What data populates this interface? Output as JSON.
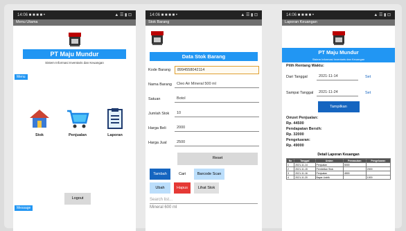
{
  "status_bar": {
    "left": "14:06 ■ ■ ■ ■ •",
    "right": "▲ ☰ ▮ ⊡"
  },
  "screen1": {
    "toolbar": "Menu Utama",
    "title": "PT Maju Mundur",
    "subtitle": "Sistem Informasi Inventaris dan Keuangan",
    "side_label": "Menu",
    "menu": [
      {
        "label": "Stok",
        "icon": "house-icon"
      },
      {
        "label": "Penjualan",
        "icon": "cart-icon"
      },
      {
        "label": "Laporan",
        "icon": "report-icon"
      }
    ],
    "logout": "Logout",
    "footer_label": "Message"
  },
  "screen2": {
    "toolbar": "Stok Barang",
    "title": "Data Stok Barang",
    "fields": [
      {
        "label": "Kode Barang",
        "value": "8994558042114"
      },
      {
        "label": "Nama Barang",
        "value": "Cleo Air Mineral 500 ml"
      },
      {
        "label": "Satuan",
        "value": "Botol"
      },
      {
        "label": "Jumlah Stok",
        "value": "10"
      },
      {
        "label": "Harga Beli",
        "value": "2000"
      },
      {
        "label": "Harga Jual",
        "value": "2500"
      }
    ],
    "reset": "Reset",
    "tambah": "Tambah",
    "cari": "Cari",
    "barcode": "Barcode Scan",
    "ubah": "Ubah",
    "hapus": "Hapus",
    "lihat": "Lihat Stok",
    "search_placeholder": "Search list...",
    "list_item": "Mineral 600 ml"
  },
  "screen3": {
    "toolbar": "Laporan Keuangan",
    "title": "PT Maju Mundur",
    "subtitle": "Sistem Informasi Inventaris dan Keuangan",
    "filter_label": "Pilih Rentang Waktu:",
    "from_label": "Dari Tanggal",
    "from_value": "2021-11-14",
    "to_label": "Sampai Tanggal",
    "to_value": "2021-11-24",
    "set": "Set",
    "submit": "Tampilkan",
    "omzet_label": "Omzet Penjualan:",
    "omzet_value": "Rp. 44500",
    "pendapatan_label": "Pendapatan Bersih:",
    "pendapatan_value": "Rp. 32000",
    "pengeluaran_label": "Pengeluaran:",
    "pengeluaran_value": "Rp. 49000",
    "table_title": "Detail Laporan Keuangan",
    "table_headers": [
      "No",
      "Tanggal",
      "Uraian",
      "Pemasukan",
      "Pengeluaran"
    ],
    "table_rows": [
      [
        "1",
        "2021-11-14",
        "Penjualan",
        "5000",
        ""
      ],
      [
        "2",
        "2021-11-15",
        "Pembelian Stok",
        "",
        "2000"
      ],
      [
        "3",
        "2021-11-16",
        "Penjualan",
        "4500",
        ""
      ],
      [
        "4",
        "2021-11-20",
        "Bayar Listrik",
        "",
        "1000"
      ]
    ]
  }
}
